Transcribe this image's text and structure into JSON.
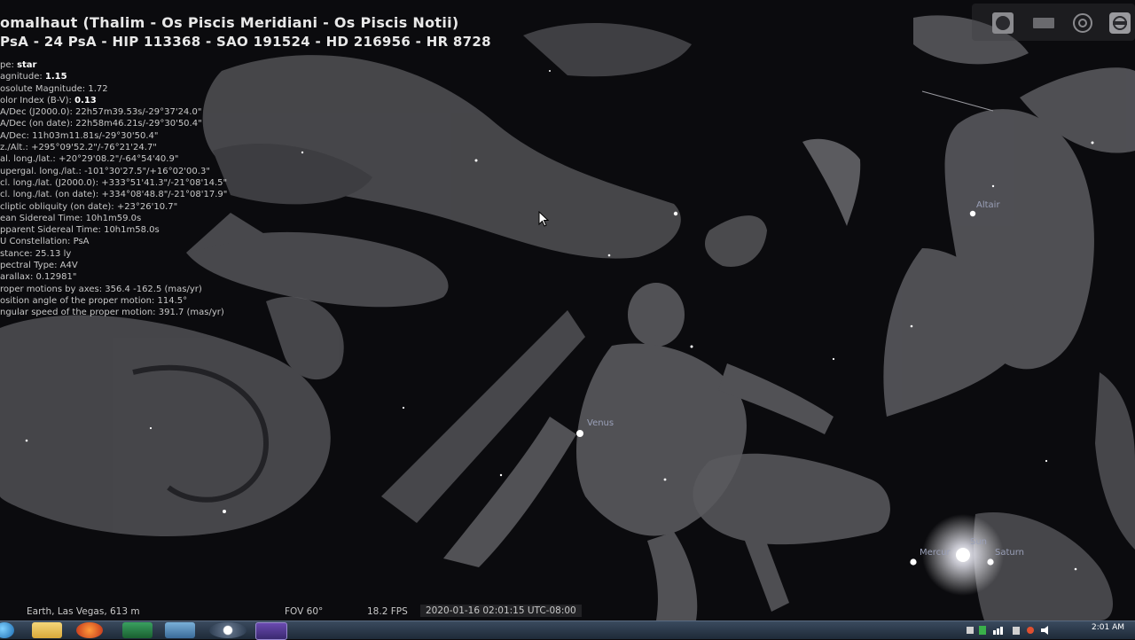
{
  "object_info": {
    "title": "omalhaut (Thalim - Os Piscis Meridiani - Os Piscis Notii)",
    "ids": "PsA - 24 PsA - HIP 113368 - SAO 191524 - HD 216956 - HR 8728",
    "lines": [
      {
        "label": "pe: ",
        "value": "star"
      },
      {
        "label": "agnitude: ",
        "value": "1.15"
      },
      {
        "label": "osolute Magnitude: 1.72",
        "value": ""
      },
      {
        "label": "olor Index (B-V): ",
        "value": "0.13"
      },
      {
        "label": "A/Dec (J2000.0): 22h57m39.53s/-29°37'24.0\"",
        "value": ""
      },
      {
        "label": "A/Dec (on date): 22h58m46.21s/-29°30'50.4\"",
        "value": ""
      },
      {
        "label": "A/Dec: 11h03m11.81s/-29°30'50.4\"",
        "value": ""
      },
      {
        "label": "z./Alt.: +295°09'52.2\"/-76°21'24.7\"",
        "value": ""
      },
      {
        "label": "al. long./lat.: +20°29'08.2\"/-64°54'40.9\"",
        "value": ""
      },
      {
        "label": "upergal. long./lat.: -101°30'27.5\"/+16°02'00.3\"",
        "value": ""
      },
      {
        "label": "cl. long./lat. (J2000.0): +333°51'41.3\"/-21°08'14.5\"",
        "value": ""
      },
      {
        "label": "cl. long./lat. (on date): +334°08'48.8\"/-21°08'17.9\"",
        "value": ""
      },
      {
        "label": "cliptic obliquity (on date): +23°26'10.7\"",
        "value": ""
      },
      {
        "label": "ean Sidereal Time: 10h1m59.0s",
        "value": ""
      },
      {
        "label": "pparent Sidereal Time: 10h1m58.0s",
        "value": ""
      },
      {
        "label": "U Constellation: PsA",
        "value": ""
      },
      {
        "label": "stance: 25.13 ly",
        "value": ""
      },
      {
        "label": "pectral Type: A4V",
        "value": ""
      },
      {
        "label": "arallax: 0.12981\"",
        "value": ""
      },
      {
        "label": "roper motions by axes: 356.4 -162.5 (mas/yr)",
        "value": ""
      },
      {
        "label": "osition angle of the proper motion: 114.5°",
        "value": ""
      },
      {
        "label": "ngular speed of the proper motion: 391.7 (mas/yr)",
        "value": ""
      }
    ]
  },
  "sky_labels": {
    "altair": "Altair",
    "venus": "Venus",
    "sun": "Sun",
    "mercury": "Mercur",
    "saturn": "Saturn"
  },
  "status": {
    "location": "Earth, Las Vegas, 613 m",
    "fov": "FOV 60°",
    "fps": "18.2 FPS",
    "datetime": "2020-01-16 02:01:15 UTC-08:00"
  },
  "taskbar": {
    "clock": "2:01 AM",
    "apps": [
      "start-orb",
      "file-explorer",
      "firefox",
      "app-green",
      "app-window",
      "app-disc",
      "stellarium"
    ]
  },
  "colors": {
    "sky": "#0b0b0e",
    "artwork": "#6e6e72",
    "taskbar": "#2a3a4e"
  }
}
